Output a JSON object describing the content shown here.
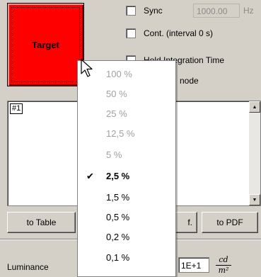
{
  "target_button": {
    "label": "Target"
  },
  "sync": {
    "label": "Sync",
    "value": "1000.00",
    "unit": "Hz"
  },
  "options": [
    {
      "label": "Cont. (interval 0 s)"
    },
    {
      "label": "Hold Integration Time"
    },
    {
      "label": "node"
    }
  ],
  "results": {
    "tag": "#1"
  },
  "buttons": {
    "to_table": "to Table",
    "f": "f.",
    "to_pdf": "to PDF"
  },
  "luminance": {
    "label": "Luminance",
    "value": "1E+1",
    "unit_num": "cd",
    "unit_den": "m²"
  },
  "dropdown": {
    "items": [
      {
        "label": "100 %",
        "state": "disabled"
      },
      {
        "label": "50 %",
        "state": "disabled"
      },
      {
        "label": "25 %",
        "state": "disabled"
      },
      {
        "label": "12,5 %",
        "state": "disabled"
      },
      {
        "label": "5 %",
        "state": "disabled"
      },
      {
        "label": "2,5 %",
        "state": "selected",
        "check": "✔"
      },
      {
        "label": "1,5 %",
        "state": "normal"
      },
      {
        "label": "0,5 %",
        "state": "normal"
      },
      {
        "label": "0,2 %",
        "state": "normal"
      },
      {
        "label": "0,1 %",
        "state": "normal"
      }
    ]
  },
  "colors": {
    "target": "#ff0000",
    "background": "#d4d0c8",
    "disabled_text": "#a0a0a0"
  }
}
